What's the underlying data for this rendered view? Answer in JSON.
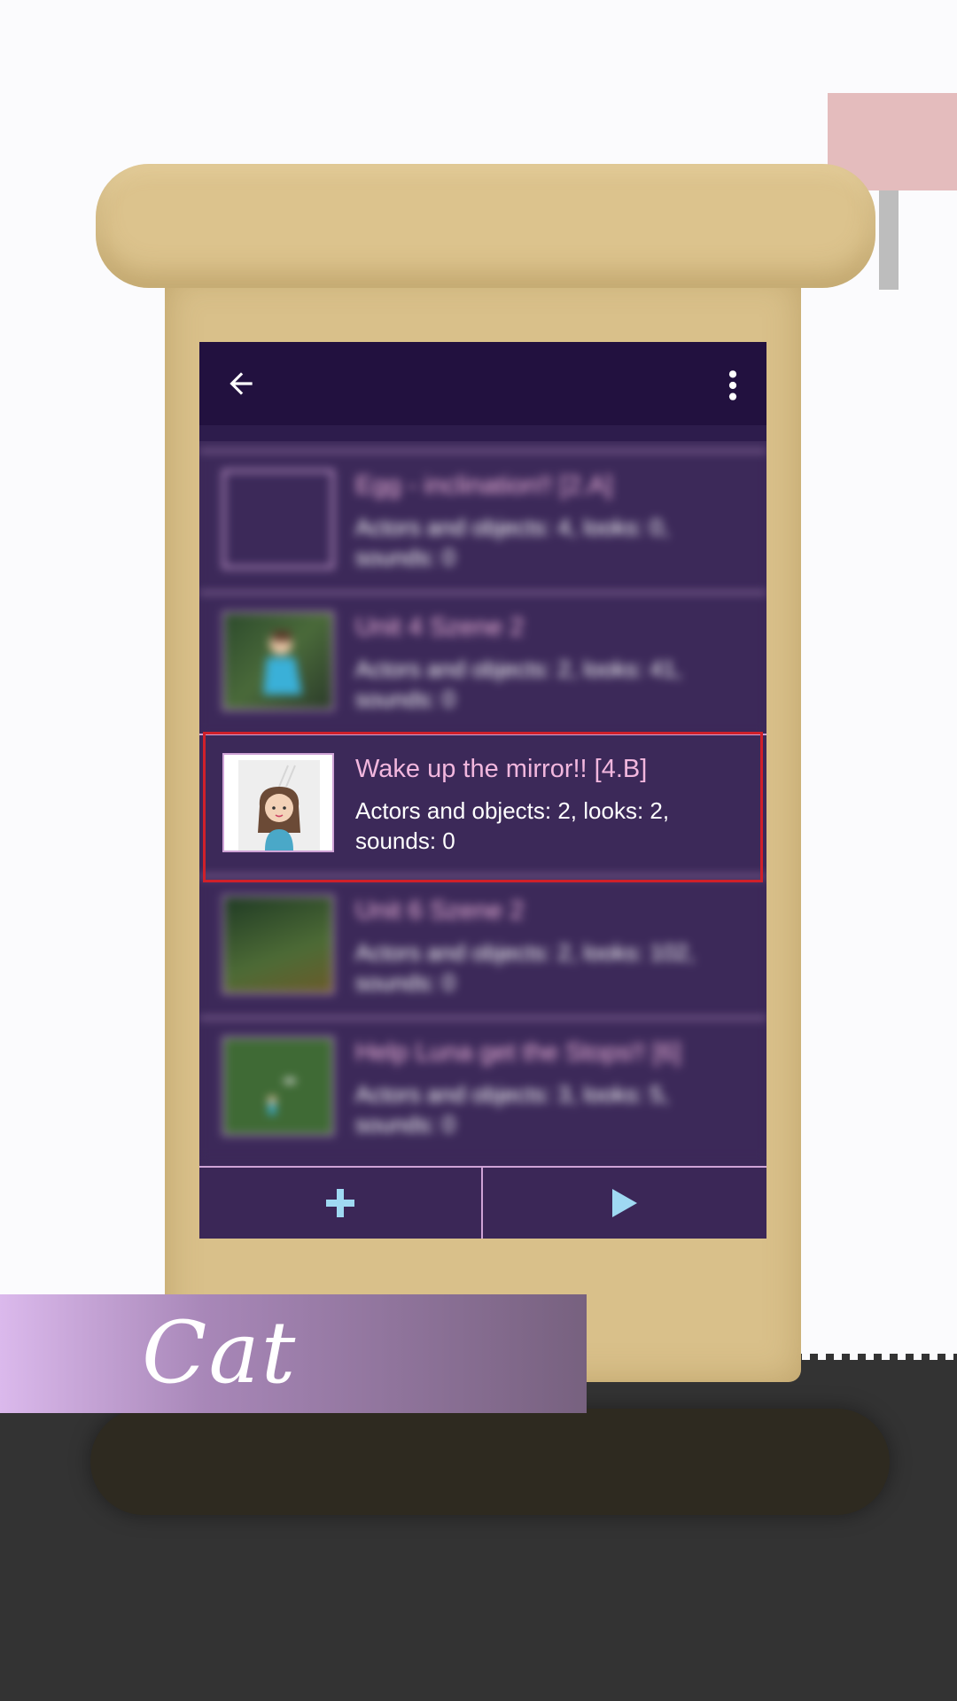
{
  "colors": {
    "toolbar": "#22113f",
    "list_bg": "#3c2959",
    "title_text": "#f2b7de",
    "accent_icon": "#9fd9f2",
    "highlight_border": "#d0202a"
  },
  "toolbar": {
    "back_icon": "arrow-left-icon",
    "menu_icon": "more-vert-icon"
  },
  "projects": [
    {
      "title": "Egg - inclination!! [2.A]",
      "details": "Actors and objects: 4, looks: 0, sounds: 0"
    },
    {
      "title": "Unit 4 Szene 2",
      "details": "Actors and objects: 2, looks: 41, sounds: 0"
    },
    {
      "title": "Wake up the mirror!! [4.B]",
      "details": "Actors and objects: 2, looks: 2, sounds: 0"
    },
    {
      "title": "Unit 6 Szene 2",
      "details": "Actors and objects: 2, looks: 102, sounds: 0"
    },
    {
      "title": "Help Luna get the Stops!! [6]",
      "details": "Actors and objects: 3, looks: 5, sounds: 0"
    }
  ],
  "bottom_bar": {
    "add_icon": "plus-icon",
    "play_icon": "play-icon"
  },
  "banner": {
    "text": "Cat"
  }
}
